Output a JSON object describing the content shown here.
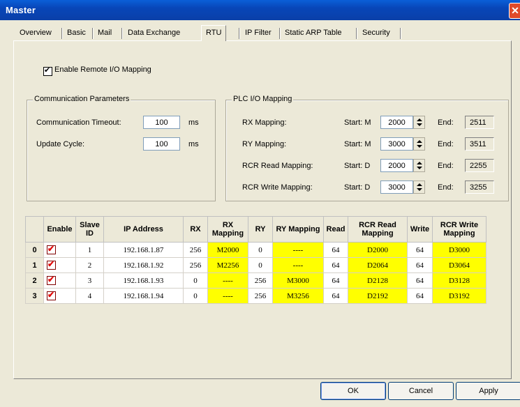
{
  "window": {
    "title": "Master"
  },
  "tabs": [
    "Overview",
    "Basic",
    "Mail",
    "Data Exchange",
    "RTU",
    "IP Filter",
    "Static ARP Table",
    "Security"
  ],
  "active_tab": "RTU",
  "enable_remote": {
    "label": "Enable Remote I/O Mapping",
    "checked": true
  },
  "comm": {
    "title": "Communication Parameters",
    "timeout_label": "Communication Timeout:",
    "timeout_value": "100",
    "timeout_unit": "ms",
    "cycle_label": "Update Cycle:",
    "cycle_value": "100",
    "cycle_unit": "ms"
  },
  "plc": {
    "title": "PLC I/O Mapping",
    "end_label": "End:",
    "rows": [
      {
        "label": "RX Mapping:",
        "start_label": "Start: M",
        "start": "2000",
        "end": "2511"
      },
      {
        "label": "RY Mapping:",
        "start_label": "Start: M",
        "start": "3000",
        "end": "3511"
      },
      {
        "label": "RCR Read Mapping:",
        "start_label": "Start: D",
        "start": "2000",
        "end": "2255"
      },
      {
        "label": "RCR Write Mapping:",
        "start_label": "Start: D",
        "start": "3000",
        "end": "3255"
      }
    ]
  },
  "grid": {
    "headers": [
      "",
      "Enable",
      "Slave ID",
      "IP Address",
      "RX",
      "RX Mapping",
      "RY",
      "RY Mapping",
      "Read",
      "RCR Read Mapping",
      "Write",
      "RCR Write Mapping"
    ],
    "rows": [
      [
        "0",
        "",
        "1",
        "192.168.1.87",
        "256",
        "M2000",
        "0",
        "----",
        "64",
        "D2000",
        "64",
        "D3000"
      ],
      [
        "1",
        "",
        "2",
        "192.168.1.92",
        "256",
        "M2256",
        "0",
        "----",
        "64",
        "D2064",
        "64",
        "D3064"
      ],
      [
        "2",
        "",
        "3",
        "192.168.1.93",
        "0",
        "----",
        "256",
        "M3000",
        "64",
        "D2128",
        "64",
        "D3128"
      ],
      [
        "3",
        "",
        "4",
        "192.168.1.94",
        "0",
        "----",
        "256",
        "M3256",
        "64",
        "D2192",
        "64",
        "D3192"
      ]
    ]
  },
  "buttons": {
    "ok": "OK",
    "cancel": "Cancel",
    "apply": "Apply"
  },
  "colors": {
    "highlight": "#ffff00",
    "titlebar": "#0a46b8"
  }
}
